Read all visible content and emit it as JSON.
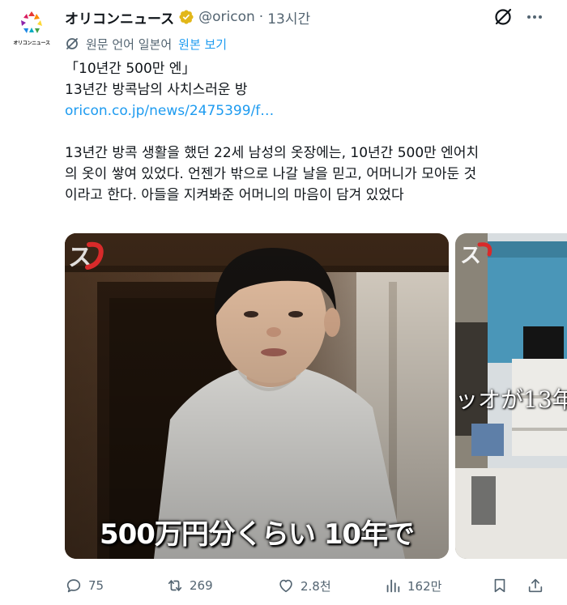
{
  "account": {
    "display_name": "オリコンニュース",
    "handle": "@oricon",
    "separator": "·",
    "time": "13시간",
    "avatar_text": "オリコンニュース"
  },
  "translation": {
    "label": "원문 언어 일본어",
    "show_original": "원본 보기"
  },
  "content": {
    "line1": "「10년간 500만 엔」",
    "line2": "13년간 방콕남의 사치스러운 방",
    "link": "oricon.co.jp/news/2475399/f…",
    "para_line1": "13년간 방콕 생활을 했던 22세 남성의 옷장에는, 10년간 500만 엔어치",
    "para_line2": "의 옷이 쌓여 있었다. 언젠가 밖으로 나갈 날을 믿고, 어머니가 모아둔 것",
    "para_line3": "이라고 한다. 아들을 지켜봐준 어머니의 마음이 담겨 있었다"
  },
  "media": {
    "left_caption": "500万円分くらい 10年で",
    "right_caption": "ッオが13年",
    "watermark": "ス"
  },
  "stats": {
    "replies": "75",
    "reposts": "269",
    "likes": "2.8천",
    "views": "162만"
  },
  "colors": {
    "accent": "#1d9bf0",
    "text": "#0f1419",
    "secondary": "#536471",
    "verified_gold": "#e2b719"
  }
}
